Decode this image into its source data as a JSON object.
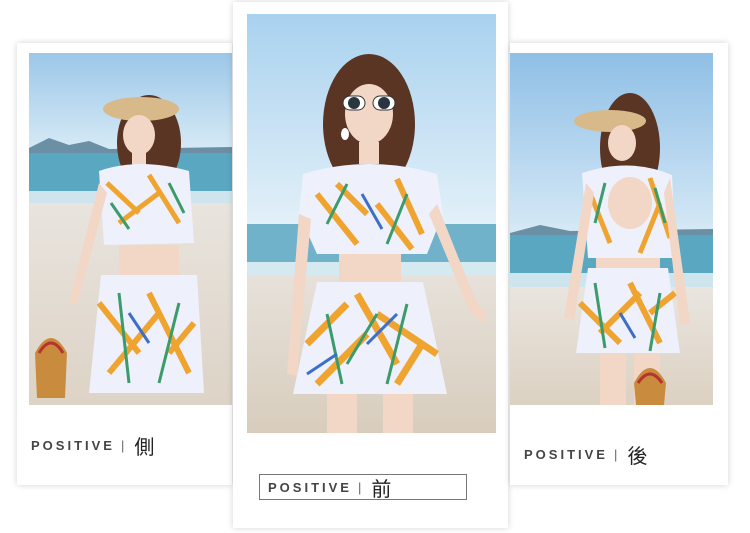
{
  "panels": [
    {
      "label": "POSITIVE",
      "separator": "|",
      "cjk": "側"
    },
    {
      "label": "POSITIVE",
      "separator": "|",
      "cjk": "前"
    },
    {
      "label": "POSITIVE",
      "separator": "|",
      "cjk": "後"
    }
  ],
  "colors": {
    "sky": "#aed4ee",
    "sea": "#6fb2c9",
    "sand": "#e9e2d8",
    "print_orange": "#f0a430",
    "print_green": "#3b9b6b",
    "print_blue": "#3c6fc7",
    "fabric": "#eef0fb",
    "hair": "#5a3524"
  }
}
